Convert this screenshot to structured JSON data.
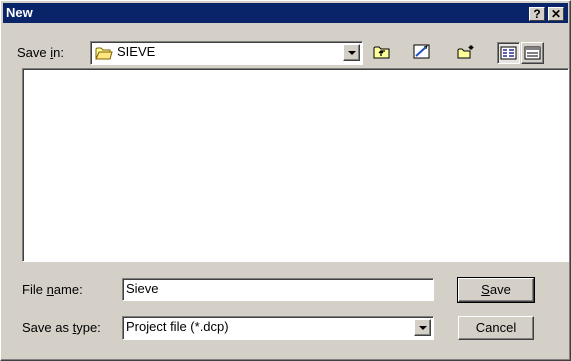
{
  "window": {
    "title": "New"
  },
  "titlebar": {
    "help_glyph": "?",
    "close_glyph": "✕"
  },
  "save_in": {
    "label_pre": "Save ",
    "label_key": "i",
    "label_post": "n:",
    "value": "SIEVE",
    "icon": "folder-icon"
  },
  "toolbar": {
    "items": [
      {
        "name": "up-one-level",
        "icon": "folder-up-icon"
      },
      {
        "name": "desktop",
        "icon": "desktop-icon"
      },
      {
        "name": "create-new-folder",
        "icon": "new-folder-icon"
      },
      {
        "name": "list-view",
        "icon": "list-view-icon"
      },
      {
        "name": "details-view",
        "icon": "details-view-icon"
      }
    ]
  },
  "file_name": {
    "label_pre": "File ",
    "label_key": "n",
    "label_post": "ame:",
    "value": "Sieve"
  },
  "save_as_type": {
    "label_pre": "Save as ",
    "label_key": "t",
    "label_post": "ype:",
    "value": "Project file (*.dcp)"
  },
  "buttons": {
    "save_key": "S",
    "save_rest": "ave",
    "cancel": "Cancel"
  },
  "colors": {
    "face": "#d4d0c8",
    "title_bg": "#0a246a",
    "window_bg": "#ffffff"
  }
}
